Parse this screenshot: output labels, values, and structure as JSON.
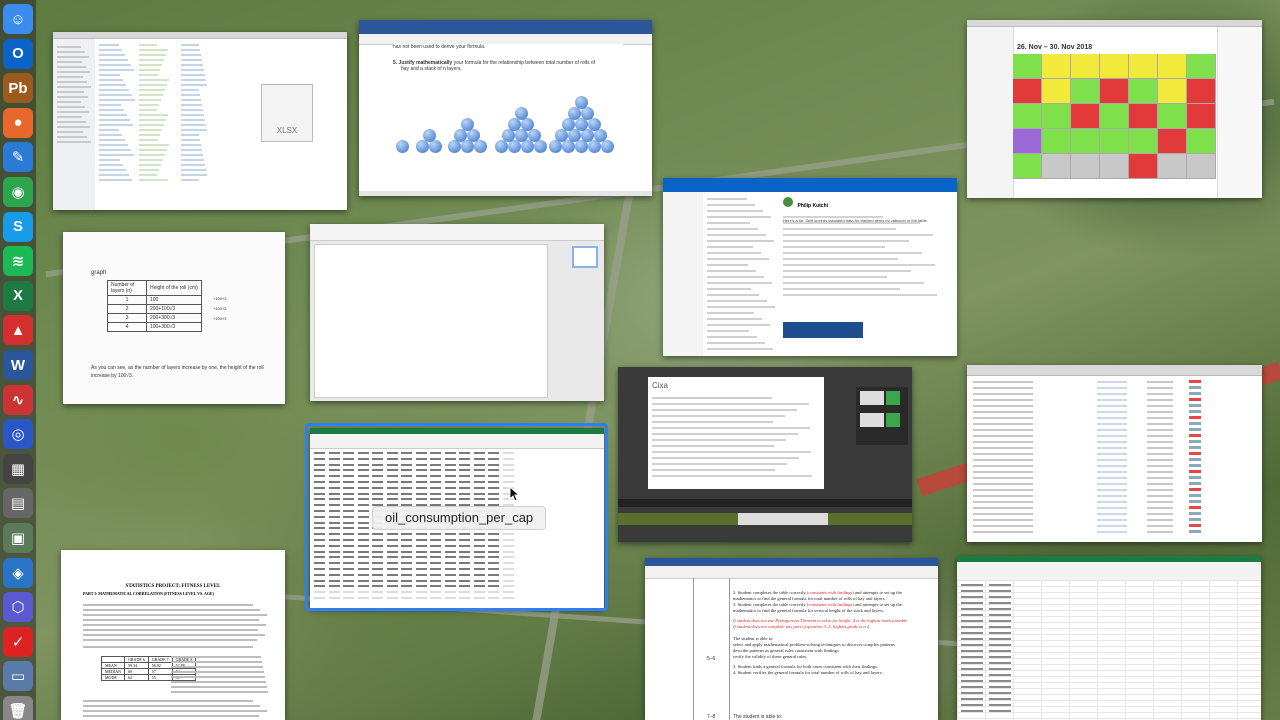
{
  "dock": {
    "icons": [
      {
        "name": "finder-icon",
        "glyph": "☺",
        "color": "#3b8ded"
      },
      {
        "name": "outlook-icon",
        "glyph": "O",
        "color": "#0a64c8"
      },
      {
        "name": "photo-booth-icon",
        "glyph": "Pb",
        "color": "#9b5b1e"
      },
      {
        "name": "firefox-icon",
        "glyph": "●",
        "color": "#e8672a"
      },
      {
        "name": "notes-icon",
        "glyph": "✎",
        "color": "#2b7bd6"
      },
      {
        "name": "chrome-icon",
        "glyph": "◉",
        "color": "#2da44e"
      },
      {
        "name": "skype-icon",
        "glyph": "S",
        "color": "#1a9be8"
      },
      {
        "name": "spotify-icon",
        "glyph": "≋",
        "color": "#1db954"
      },
      {
        "name": "excel-icon",
        "glyph": "X",
        "color": "#1e7a43"
      },
      {
        "name": "acrobat-icon",
        "glyph": "▲",
        "color": "#d32f2f"
      },
      {
        "name": "word-icon",
        "glyph": "W",
        "color": "#2b579a"
      },
      {
        "name": "grapher-icon",
        "glyph": "∿",
        "color": "#c33"
      },
      {
        "name": "screen-recorder-icon",
        "glyph": "◎",
        "color": "#2a56c6"
      },
      {
        "name": "app-store-icon",
        "glyph": "▦",
        "color": "#444"
      },
      {
        "name": "calculator-icon",
        "glyph": "▤",
        "color": "#666"
      },
      {
        "name": "preview-icon",
        "glyph": "▣",
        "color": "#5a7a5a"
      },
      {
        "name": "maps-icon",
        "glyph": "◈",
        "color": "#2a74c8"
      },
      {
        "name": "geogebra-icon",
        "glyph": "⬡",
        "color": "#5a5ad0"
      },
      {
        "name": "tick-app-icon",
        "glyph": "✓",
        "color": "#d22"
      },
      {
        "name": "image-capture-icon",
        "glyph": "▭",
        "color": "#5a7aa8"
      },
      {
        "name": "trash-icon",
        "glyph": "🗑",
        "color": "#888"
      }
    ]
  },
  "windows": {
    "finder": {
      "file_label": "XLSX"
    },
    "word_doc": {
      "line1": "has not been used to derive your formula.",
      "line2_bold": "5. Justify mathematically",
      "line2_rest": " your formula for the relationship between total number of rolls of",
      "line3": "hay and a stack of n layers."
    },
    "calendar": {
      "range": "26. Nov – 30. Nov 2018"
    },
    "handwritten": {
      "title": "graph",
      "headers": [
        "Number of layers (n)",
        "Height of the roll (cm)"
      ],
      "rows": [
        [
          "1",
          "100"
        ],
        [
          "2",
          "200+100√3"
        ],
        [
          "3",
          "200+300√3"
        ],
        [
          "4",
          "100+300√3"
        ]
      ],
      "annotations": [
        "+100√3",
        "+100√3",
        "+100√3"
      ],
      "note": "As you can see, as the number of layers increase by one, the height of the roll increase by 100√3."
    },
    "excel_selected": {
      "label": "oil_consumption_per_cap"
    },
    "mail": {
      "from": "Philip Kutchi",
      "body": "Here's a tip: Split speeds tabulated data for tracked items by category in the table."
    },
    "lesson_doc": {
      "item1_a": "Student completes the table correctly",
      "item1_b": " (consistent with findings)",
      "item1_c": " and attempts to set up the mathematics to find the general formula for total number of rolls of hay and layers.",
      "item2_a": "Student completes the table correctly",
      "item2_b": " (consistent with findings)",
      "item2_c": " and attempts to set up the mathematics to find the general formula for vertical height of the stack and layers.",
      "note1": "If student does not use Pythagorean Theorem to solve for height, 4 is the highest mark possible.",
      "note2": "If student does not complete any part of question 3–5, highest grade is a 2.",
      "grade": "5–6",
      "able": "The student is able to:",
      "b1": "select and apply mathematical problem-solving techniques to discover complex patterns",
      "b2": "describe patterns as general rules consistent with findings",
      "b3": "verify the validity of these general rules.",
      "b4": "3. Student finds a general formula for both cases consistent with their findings.",
      "b5": "4. Student verifies the general formula for total number of rolls of hay and layers.",
      "next_grade": "7–8",
      "next_able": "The student is able to:"
    },
    "stats_paper": {
      "title": "STATISTICS PROJECT: FITNESS LEVEL",
      "subtitle": "PART I: MATHEMATICAL CORRELATION (FITNESS LEVEL VS. AGE)",
      "table_headers": [
        "",
        "GRADE 6",
        "GRADE 7",
        "GRADE 8"
      ],
      "table_rows": [
        [
          "MEAN",
          "59.34",
          "56.92",
          "52.88"
        ],
        [
          "MEDIAN",
          "60",
          "57",
          "53"
        ],
        [
          "MODE",
          "62",
          "55",
          "50"
        ]
      ]
    }
  }
}
